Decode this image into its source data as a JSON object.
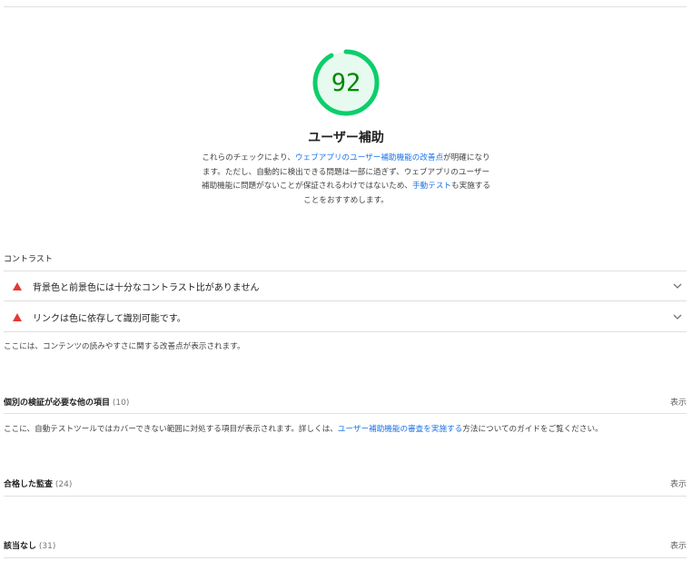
{
  "score": {
    "value": "92",
    "fraction": 0.92,
    "color": "#0cce6b",
    "text_color": "#008800",
    "bg": "#e6faef"
  },
  "section": {
    "title": "ユーザー補助",
    "description_parts": {
      "p1": "これらのチェックにより、",
      "link1": "ウェブアプリのユーザー補助機能の改善点",
      "p2": "が明確になります。ただし、自動的に検出できる問題は一部に過ぎず、ウェブアプリのユーザー補助機能に問題がないことが保証されるわけではないため、",
      "link2": "手動テスト",
      "p3": "も実施することをおすすめします。"
    }
  },
  "contrast": {
    "title": "コントラスト",
    "audits": [
      {
        "label": "背景色と前景色には十分なコントラスト比がありません",
        "icon": "fail-triangle-icon"
      },
      {
        "label": "リンクは色に依存して識別可能です。",
        "icon": "fail-triangle-icon"
      }
    ],
    "note": "ここには、コンテンツの読みやすさに関する改善点が表示されます。"
  },
  "manual": {
    "title": "個別の検証が必要な他の項目",
    "count": "(10)",
    "show": "表示",
    "note_parts": {
      "p1": "ここに、自動テストツールではカバーできない範囲に対処する項目が表示されます。詳しくは、",
      "link": "ユーザー補助機能の審査を実施する",
      "p2": "方法についてのガイドをご覧ください。"
    }
  },
  "passed": {
    "title": "合格した監査",
    "count": "(24)",
    "show": "表示"
  },
  "notapplicable": {
    "title": "該当なし",
    "count": "(31)",
    "show": "表示"
  }
}
